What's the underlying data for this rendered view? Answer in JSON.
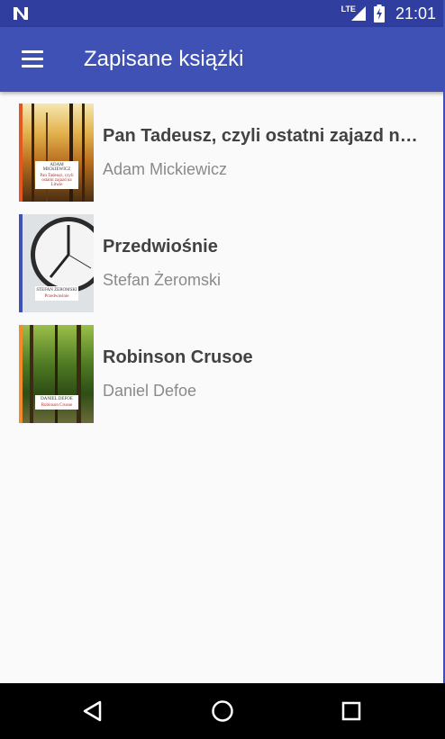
{
  "status_bar": {
    "network": "LTE",
    "time": "21:01"
  },
  "app_bar": {
    "title": "Zapisane książki"
  },
  "books": [
    {
      "title": "Pan Tadeusz, czyli ostatni zajazd na Litwie",
      "author": "Adam Mickiewicz",
      "cover_author": "ADAM MICKIEWICZ",
      "cover_title": "Pan Tadeusz, czyli ostatni zajazd na Litwie",
      "spine_color": "#e2571e"
    },
    {
      "title": "Przedwiośnie",
      "author": "Stefan Żeromski",
      "cover_author": "STEFAN ŻEROMSKI",
      "cover_title": "Przedwiośnie",
      "spine_color": "#3f51b5"
    },
    {
      "title": "Robinson Crusoe",
      "author": "Daniel Defoe",
      "cover_author": "DANIEL DEFOE",
      "cover_title": "Robinson Crusoe",
      "spine_color": "#f28c28"
    }
  ],
  "colors": {
    "status_bar": "#303f9f",
    "app_bar": "#3f51b5",
    "background": "#fafafa",
    "title_text": "#424242",
    "author_text": "#8a8a8a"
  },
  "nav_bar": {
    "back_icon": "back-triangle-icon",
    "home_icon": "home-circle-icon",
    "recents_icon": "recents-square-icon"
  }
}
